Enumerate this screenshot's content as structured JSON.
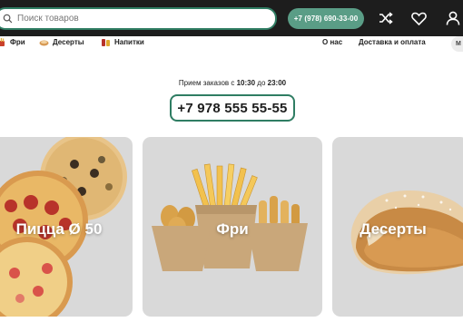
{
  "header": {
    "search_placeholder": "Поиск товаров",
    "phone_button": "+7 (978) 690-33-00",
    "icons": [
      "search-icon",
      "shuffle-icon",
      "heart-icon",
      "user-icon"
    ]
  },
  "categories": [
    {
      "label": "Фри",
      "icon": "fries-icon"
    },
    {
      "label": "Десерты",
      "icon": "dessert-icon"
    },
    {
      "label": "Напитки",
      "icon": "drink-icon"
    }
  ],
  "right_nav": {
    "about": "О нас",
    "delivery": "Доставка и оплата",
    "avatar": "M"
  },
  "order_info": {
    "hours_prefix": "Прием заказов с ",
    "time_from": "10:30",
    "hours_middle": " до ",
    "time_to": "23:00",
    "phone": "+7 978 555 55-55"
  },
  "cards": [
    {
      "title": "Пицца Ø 50",
      "image": "pizza"
    },
    {
      "title": "Фри",
      "image": "fries-nuggets"
    },
    {
      "title": "Десерты",
      "image": "strudel"
    }
  ],
  "colors": {
    "topbar": "#1d1d1d",
    "accent": "#2f7d63",
    "phone_button": "#5a9d86",
    "card_bg": "#d9d9d9"
  }
}
